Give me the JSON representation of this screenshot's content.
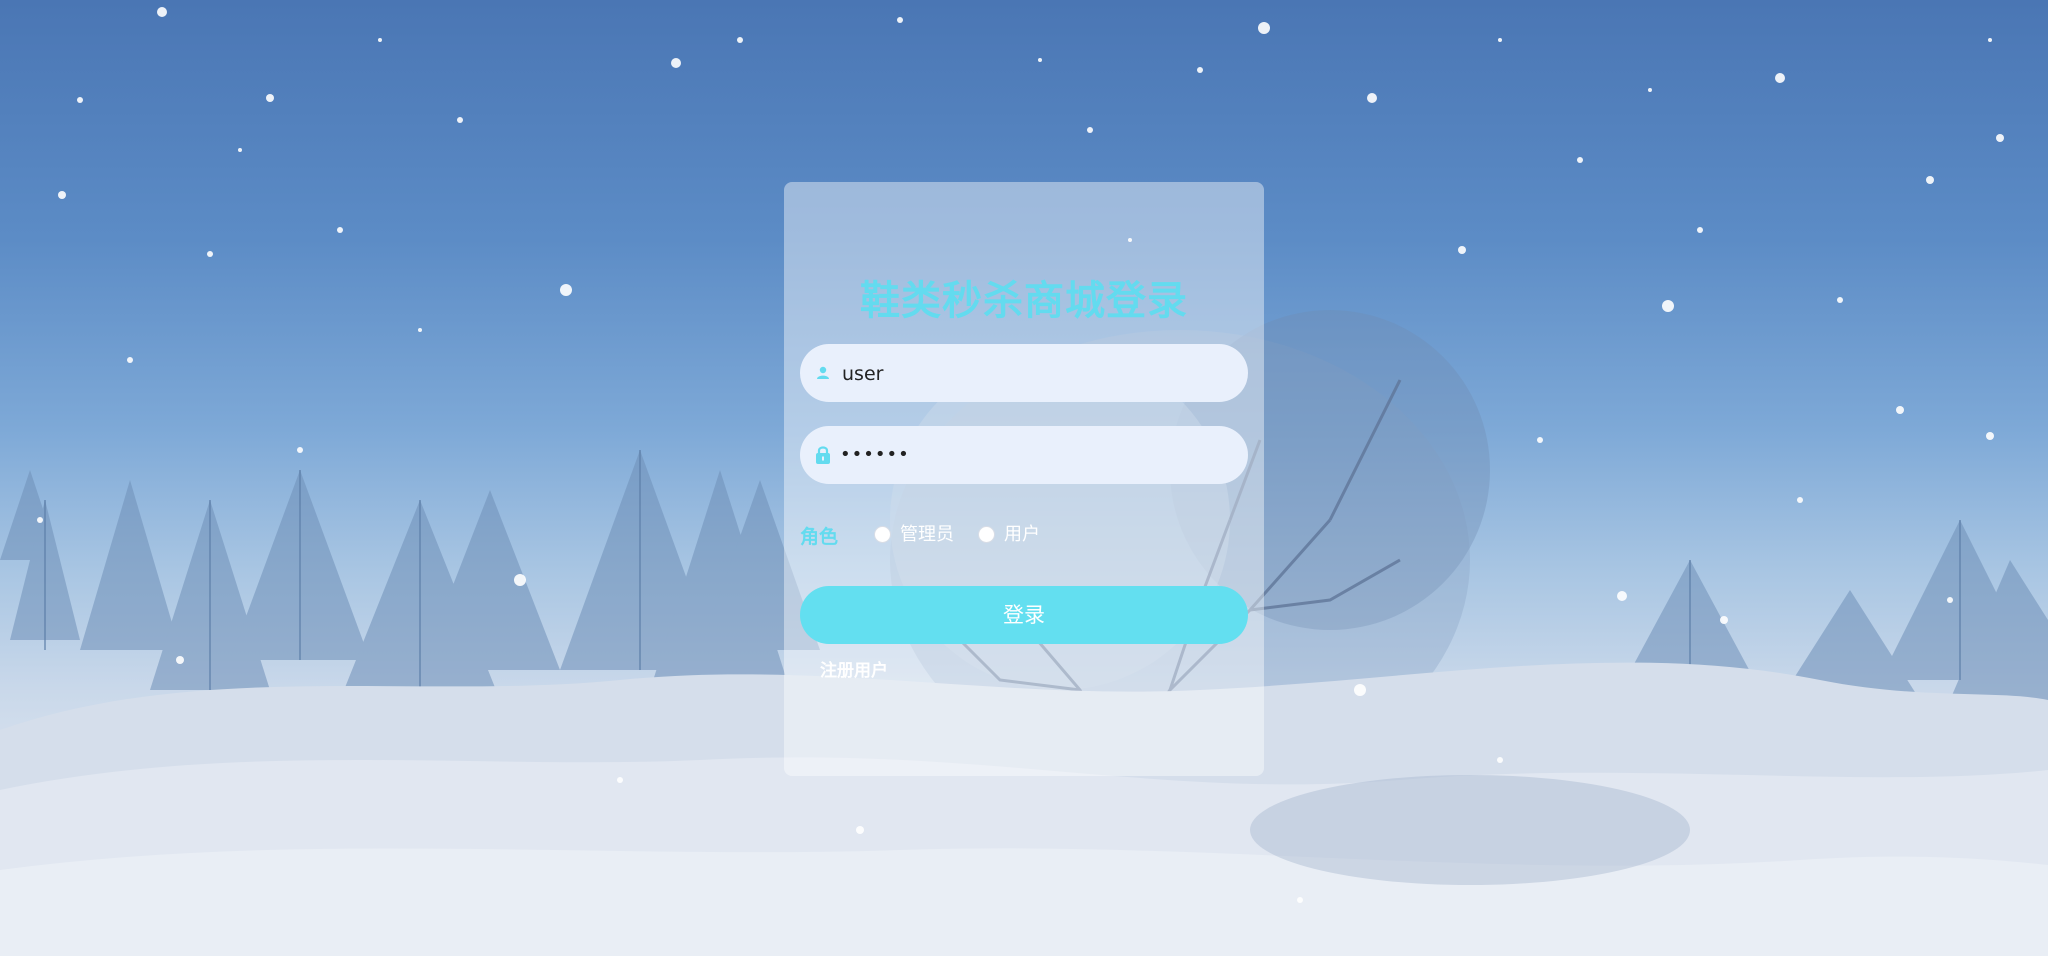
{
  "login": {
    "title": "鞋类秒杀商城登录",
    "username": {
      "value": "user",
      "icon": "user-icon"
    },
    "password": {
      "value": "••••••",
      "icon": "lock-icon"
    },
    "role": {
      "label": "角色",
      "options": [
        "管理员",
        "用户"
      ]
    },
    "submit_label": "登录",
    "register_label": "注册用户"
  },
  "colors": {
    "accent": "#63dbef",
    "button": "#63dff0",
    "input_bg": "#e9f0fc",
    "sky_top": "#4a76b4",
    "snow": "#e6ebf3"
  }
}
